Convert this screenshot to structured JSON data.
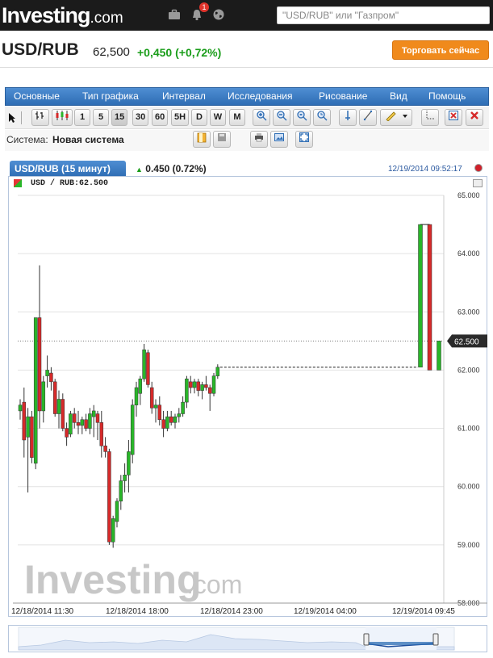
{
  "topbar": {
    "logo_main": "Investing",
    "logo_suffix": ".com",
    "notification_count": "1",
    "search_placeholder": "\"USD/RUB\" или \"Газпром\"",
    "icons": [
      "briefcase-icon",
      "bell-icon",
      "globe-icon"
    ]
  },
  "instrument": {
    "name": "USD/RUB",
    "price": "62,500",
    "change": "+0,450 (+0,72%)",
    "trade_button": "Торговать сейчас"
  },
  "menu": [
    "Основные",
    "Тип графика",
    "Интервал",
    "Исследования",
    "Рисование",
    "Вид",
    "Помощь"
  ],
  "toolbar": {
    "intervals": [
      "1",
      "5",
      "15",
      "30",
      "60",
      "5H",
      "D",
      "W",
      "M"
    ],
    "active_interval": "15"
  },
  "system": {
    "label": "Система:",
    "value": "Новая система"
  },
  "chart_panel": {
    "tab_label": "USD/RUB (15 минут)",
    "tab_change": "0.450 (0.72%)",
    "timestamp": "12/19/2014 09:52:17",
    "legend": "USD / RUB:62.500",
    "current_price_label": "62.500",
    "watermark_main": "Investing",
    "watermark_suffix": ".com"
  },
  "colors": {
    "up": "#29b629",
    "down": "#d62a2a",
    "accent": "#2e6db4",
    "trade_button": "#f08a1c",
    "change_positive": "#1a9d1a"
  },
  "chart_data": {
    "type": "candlestick",
    "title": "USD / RUB",
    "y_ticks": [
      "65.000",
      "64.000",
      "63.000",
      "62.000",
      "61.000",
      "60.000",
      "59.000",
      "58.000"
    ],
    "ylim": [
      58.0,
      65.0
    ],
    "x_ticks": [
      "12/18/2014 11:30",
      "12/18/2014 18:00",
      "12/18/2014 23:00",
      "12/19/2014 04:00",
      "12/19/2014 09:45"
    ],
    "last_price": 62.5,
    "gap_reference_price": 62.05,
    "grid": true,
    "candles": [
      {
        "o": 61.3,
        "h": 61.5,
        "l": 61.15,
        "c": 61.4
      },
      {
        "o": 61.45,
        "h": 61.7,
        "l": 60.5,
        "c": 60.8
      },
      {
        "o": 60.85,
        "h": 61.35,
        "l": 59.9,
        "c": 61.2
      },
      {
        "o": 61.2,
        "h": 61.3,
        "l": 60.4,
        "c": 60.5
      },
      {
        "o": 60.4,
        "h": 62.7,
        "l": 60.3,
        "c": 62.9
      },
      {
        "o": 62.9,
        "h": 63.8,
        "l": 61.0,
        "c": 61.3
      },
      {
        "o": 61.3,
        "h": 61.9,
        "l": 61.1,
        "c": 61.8
      },
      {
        "o": 61.9,
        "h": 62.25,
        "l": 61.7,
        "c": 62.0
      },
      {
        "o": 61.95,
        "h": 62.05,
        "l": 61.65,
        "c": 61.8
      },
      {
        "o": 61.8,
        "h": 61.85,
        "l": 61.2,
        "c": 61.25
      },
      {
        "o": 61.25,
        "h": 61.65,
        "l": 61.0,
        "c": 61.5
      },
      {
        "o": 61.5,
        "h": 61.6,
        "l": 60.95,
        "c": 61.0
      },
      {
        "o": 61.0,
        "h": 61.1,
        "l": 60.7,
        "c": 60.85
      },
      {
        "o": 60.9,
        "h": 61.3,
        "l": 60.85,
        "c": 61.25
      },
      {
        "o": 61.25,
        "h": 61.35,
        "l": 61.0,
        "c": 61.1
      },
      {
        "o": 61.1,
        "h": 61.3,
        "l": 60.9,
        "c": 61.05
      },
      {
        "o": 61.05,
        "h": 61.2,
        "l": 60.9,
        "c": 61.15
      },
      {
        "o": 61.15,
        "h": 61.25,
        "l": 60.95,
        "c": 61.0
      },
      {
        "o": 61.0,
        "h": 61.35,
        "l": 60.9,
        "c": 61.25
      },
      {
        "o": 61.2,
        "h": 61.4,
        "l": 60.85,
        "c": 61.3
      },
      {
        "o": 61.25,
        "h": 61.3,
        "l": 60.8,
        "c": 61.1
      },
      {
        "o": 61.1,
        "h": 61.3,
        "l": 60.5,
        "c": 60.7
      },
      {
        "o": 60.7,
        "h": 60.85,
        "l": 60.5,
        "c": 60.6
      },
      {
        "o": 60.6,
        "h": 60.65,
        "l": 59.0,
        "c": 59.05
      },
      {
        "o": 59.05,
        "h": 59.5,
        "l": 58.95,
        "c": 59.45
      },
      {
        "o": 59.4,
        "h": 59.8,
        "l": 59.3,
        "c": 59.75
      },
      {
        "o": 59.75,
        "h": 60.2,
        "l": 59.6,
        "c": 60.1
      },
      {
        "o": 60.1,
        "h": 60.4,
        "l": 59.9,
        "c": 60.2
      },
      {
        "o": 60.2,
        "h": 60.8,
        "l": 59.9,
        "c": 60.6
      },
      {
        "o": 60.55,
        "h": 61.5,
        "l": 60.4,
        "c": 61.4
      },
      {
        "o": 61.4,
        "h": 61.8,
        "l": 61.2,
        "c": 61.7
      },
      {
        "o": 61.6,
        "h": 61.9,
        "l": 61.4,
        "c": 61.85
      },
      {
        "o": 61.85,
        "h": 62.45,
        "l": 61.8,
        "c": 62.35
      },
      {
        "o": 62.3,
        "h": 62.35,
        "l": 61.7,
        "c": 61.75
      },
      {
        "o": 61.7,
        "h": 61.8,
        "l": 61.25,
        "c": 61.35
      },
      {
        "o": 61.35,
        "h": 61.5,
        "l": 61.1,
        "c": 61.4
      },
      {
        "o": 61.4,
        "h": 61.55,
        "l": 61.05,
        "c": 61.15
      },
      {
        "o": 61.15,
        "h": 61.3,
        "l": 60.85,
        "c": 61.0
      },
      {
        "o": 61.0,
        "h": 61.3,
        "l": 60.95,
        "c": 61.2
      },
      {
        "o": 61.2,
        "h": 61.3,
        "l": 61.05,
        "c": 61.1
      },
      {
        "o": 61.1,
        "h": 61.25,
        "l": 61.0,
        "c": 61.2
      },
      {
        "o": 61.2,
        "h": 61.35,
        "l": 61.1,
        "c": 61.25
      },
      {
        "o": 61.25,
        "h": 61.55,
        "l": 61.2,
        "c": 61.45
      },
      {
        "o": 61.45,
        "h": 61.9,
        "l": 61.35,
        "c": 61.85
      },
      {
        "o": 61.8,
        "h": 61.9,
        "l": 61.6,
        "c": 61.7
      },
      {
        "o": 61.7,
        "h": 61.85,
        "l": 61.6,
        "c": 61.8
      },
      {
        "o": 61.8,
        "h": 61.85,
        "l": 61.55,
        "c": 61.65
      },
      {
        "o": 61.65,
        "h": 61.8,
        "l": 61.5,
        "c": 61.75
      },
      {
        "o": 61.75,
        "h": 61.9,
        "l": 61.65,
        "c": 61.7
      },
      {
        "o": 61.7,
        "h": 61.75,
        "l": 61.3,
        "c": 61.6
      },
      {
        "o": 61.6,
        "h": 61.95,
        "l": 61.55,
        "c": 61.9
      },
      {
        "o": 61.9,
        "h": 62.1,
        "l": 61.85,
        "c": 62.05
      },
      {
        "o": 62.05,
        "h": 64.5,
        "l": 62.05,
        "c": 64.5
      },
      {
        "o": 64.5,
        "h": 64.5,
        "l": 62.0,
        "c": 62.0
      },
      {
        "o": 62.0,
        "h": 62.5,
        "l": 62.0,
        "c": 62.5
      }
    ]
  }
}
